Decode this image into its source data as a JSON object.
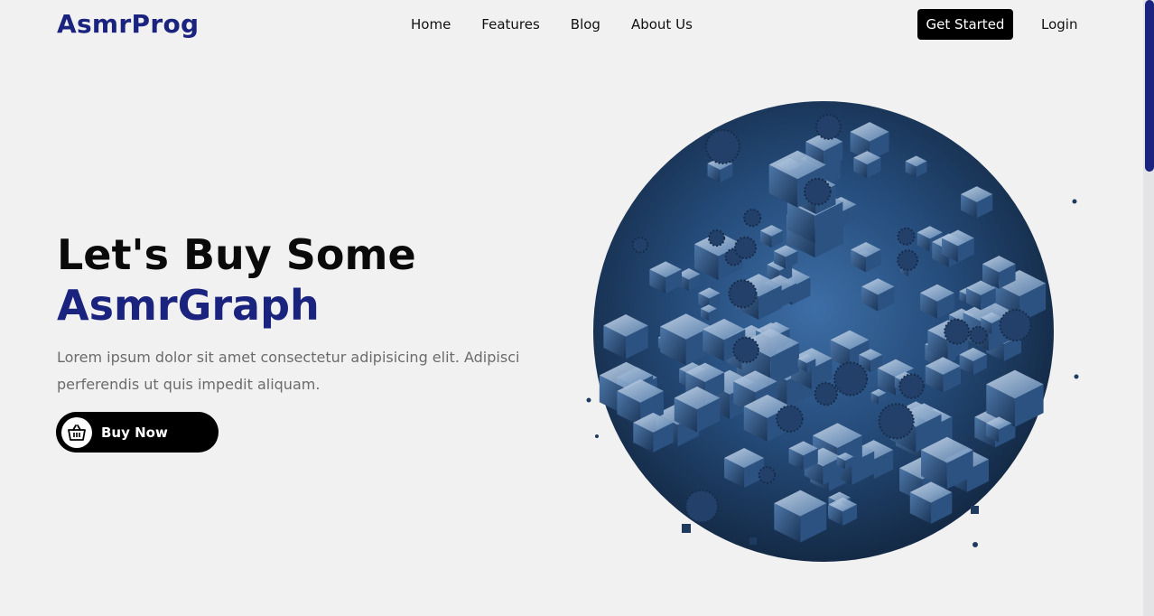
{
  "brand": {
    "logo": "AsmrProg"
  },
  "nav": {
    "items": [
      "Home",
      "Features",
      "Blog",
      "About Us"
    ]
  },
  "header": {
    "get_started": "Get Started",
    "login": "Login"
  },
  "hero": {
    "title_line1": "Let's Buy Some",
    "title_line2": "AsmrGraph",
    "description": "Lorem ipsum dolor sit amet consectetur adipisicing elit. Adipisci perferendis ut quis impedit aliquam.",
    "buy_label": "Buy Now",
    "buy_icon": "basket-icon"
  },
  "colors": {
    "brand": "#1a237e",
    "background": "#f1f1f2",
    "button": "#000000"
  }
}
